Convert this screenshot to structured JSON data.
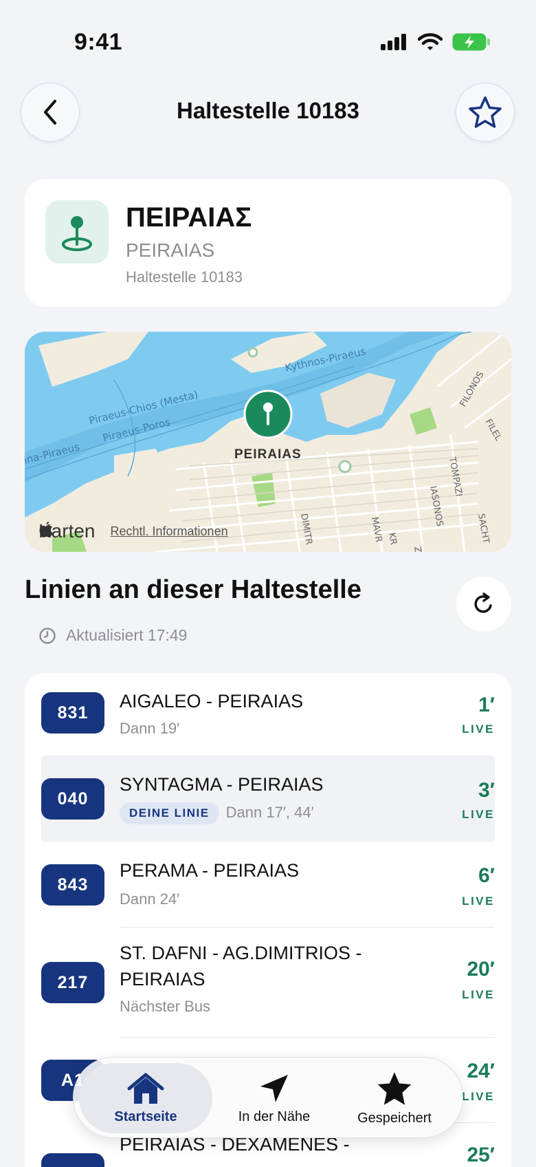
{
  "status_bar": {
    "time": "9:41"
  },
  "header": {
    "title": "Haltestelle 10183"
  },
  "stop": {
    "name": "ΠΕΙΡΑΙΑΣ",
    "name_latin": "PEIRAIAS",
    "subtitle": "Haltestelle 10183"
  },
  "map": {
    "pin_label": "PEIRAIAS",
    "brand": "Karten",
    "legal": "Rechtl. Informationen",
    "labels": {
      "kythnos": "Kythnos-Piraeus",
      "chios": "Piraeus-Chios (Mesta)",
      "poros": "Piraeus-Poros",
      "aegina": "ina-Piraeus",
      "filonos": "FILONOS",
      "filel": "FILEL",
      "tompazi": "TOMPAZI",
      "iasonos": "IASONOS",
      "dimitr": "DIMITR",
      "mavr": "MAVR",
      "kr": "KR",
      "sacht": "SACHT",
      "z": "Z"
    }
  },
  "lines_section": {
    "title": "Linien an dieser Haltestelle",
    "updated": "Aktualisiert 17:49"
  },
  "lines": [
    {
      "number": "831",
      "destination": "AIGALEO - PEIRAIAS",
      "then": "Dann 19′",
      "minutes": "1′",
      "live": "LIVE"
    },
    {
      "number": "040",
      "destination": "SYNTAGMA - PEIRAIAS",
      "chip": "DEINE LINIE",
      "then": "Dann 17′, 44′",
      "minutes": "3′",
      "live": "LIVE"
    },
    {
      "number": "843",
      "destination": "PERAMA - PEIRAIAS",
      "then": "Dann 24′",
      "minutes": "6′",
      "live": "LIVE"
    },
    {
      "number": "217",
      "destination_line1": "ST. DAFNI - AG.DIMITRIOS -",
      "destination_line2": "PEIRAIAS",
      "then": "Nächster Bus",
      "minutes": "20′",
      "live": "LIVE"
    },
    {
      "number": "A1",
      "minutes": "24′",
      "live": "LIVE"
    },
    {
      "destination": "PEIRAIAS - DEXAMENES -",
      "minutes": "25′"
    }
  ],
  "tabbar": {
    "home": "Startseite",
    "nearby": "In der Nähe",
    "saved": "Gespeichert"
  },
  "colors": {
    "accent": "#17357f",
    "live": "#1b7c58",
    "pin": "#1a8a5c"
  }
}
